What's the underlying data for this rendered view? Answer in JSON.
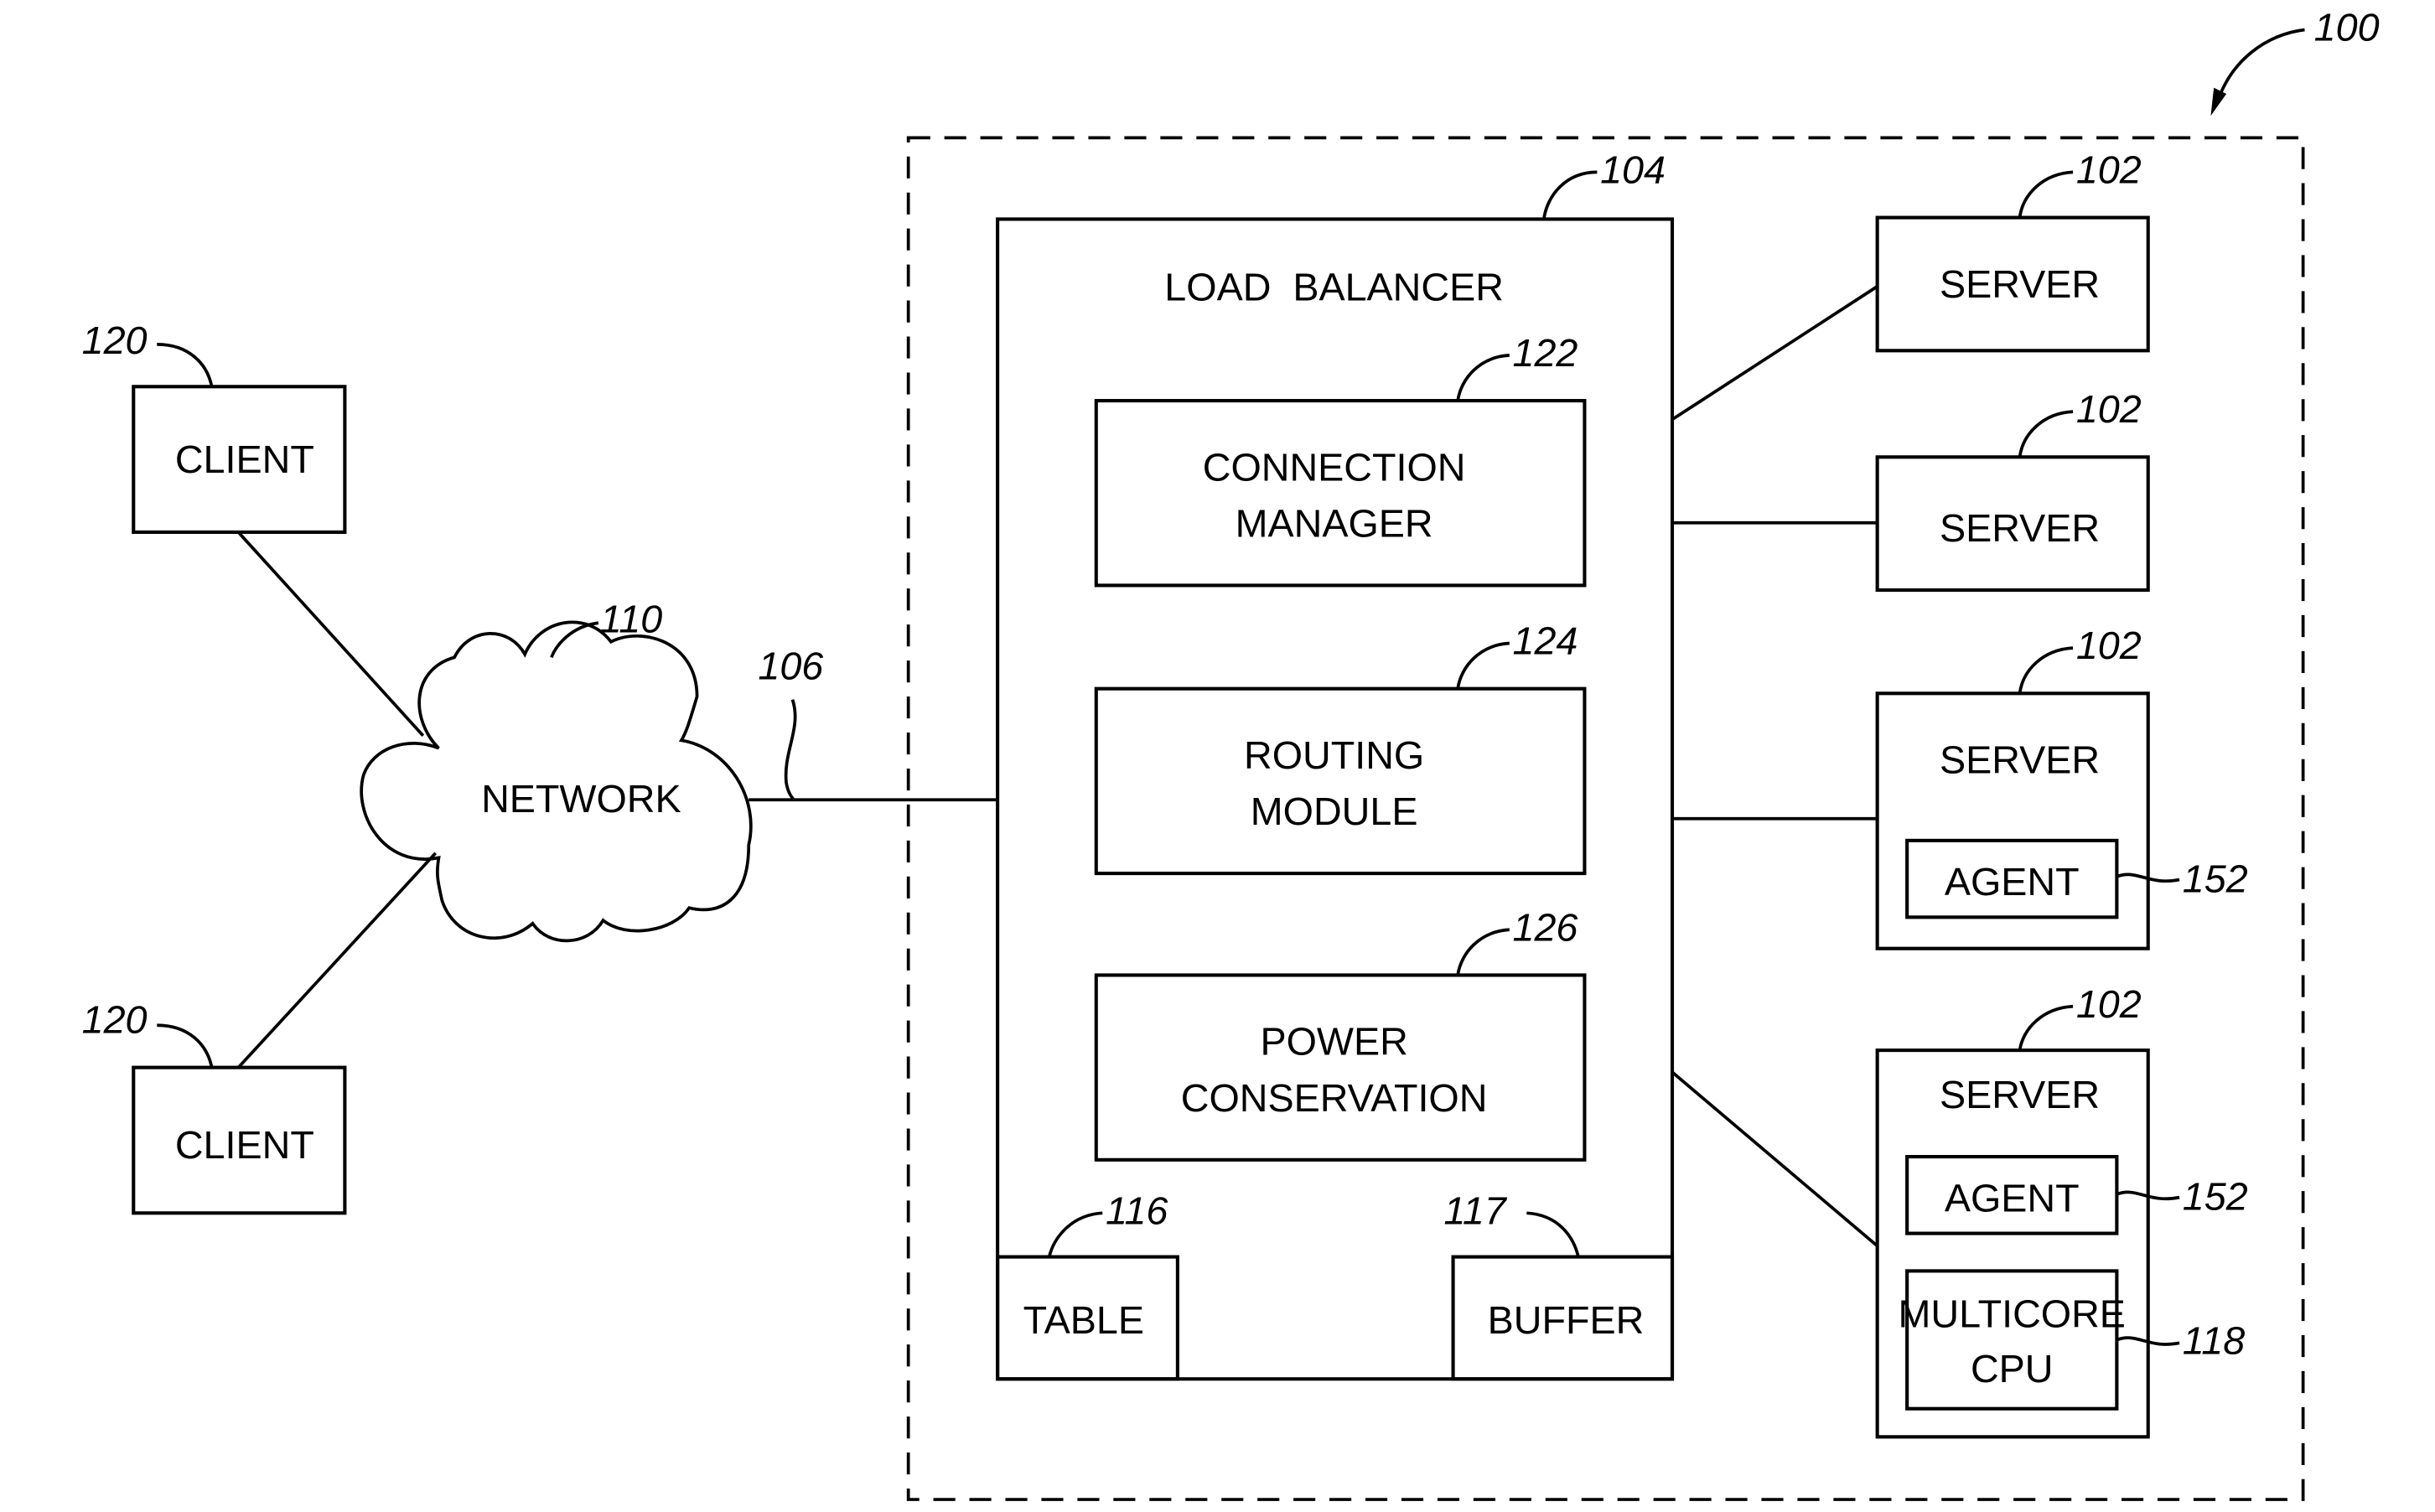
{
  "figure": {
    "system_ref": "100",
    "clients": [
      {
        "label": "CLIENT",
        "ref": "120"
      },
      {
        "label": "CLIENT",
        "ref": "120"
      }
    ],
    "network": {
      "label": "NETWORK",
      "ref": "110",
      "link_ref": "106"
    },
    "load_balancer": {
      "label": "LOAD  BALANCER",
      "ref": "104",
      "modules": [
        {
          "line1": "CONNECTION",
          "line2": "MANAGER",
          "ref": "122"
        },
        {
          "line1": "ROUTING",
          "line2": "MODULE",
          "ref": "124"
        },
        {
          "line1": "POWER",
          "line2": "CONSERVATION",
          "ref": "126"
        }
      ],
      "table": {
        "label": "TABLE",
        "ref": "116"
      },
      "buffer": {
        "label": "BUFFER",
        "ref": "117"
      }
    },
    "servers": [
      {
        "label": "SERVER",
        "ref": "102"
      },
      {
        "label": "SERVER",
        "ref": "102"
      },
      {
        "label": "SERVER",
        "ref": "102",
        "agent": {
          "label": "AGENT",
          "ref": "152"
        }
      },
      {
        "label": "SERVER",
        "ref": "102",
        "agent": {
          "label": "AGENT",
          "ref": "152"
        },
        "cpu": {
          "line1": "MULTICORE",
          "line2": "CPU",
          "ref": "118"
        }
      }
    ]
  }
}
